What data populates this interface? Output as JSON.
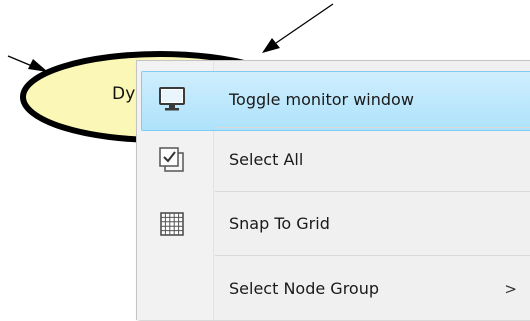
{
  "canvas": {
    "node": {
      "label_visible": "Dy"
    }
  },
  "context_menu": {
    "items": [
      {
        "label": "Toggle monitor window",
        "icon": "monitor-icon",
        "highlighted": true
      },
      {
        "label": "Select All",
        "icon": "select-all-icon"
      },
      {
        "label": "Snap To Grid",
        "icon": "grid-icon"
      },
      {
        "label": "Select Node Group",
        "icon": "",
        "submenu_arrow": ">"
      }
    ]
  },
  "colors": {
    "node_fill": "#fbf7b6",
    "highlight": "#aee2fb",
    "menu_bg": "#f0f0f0"
  }
}
